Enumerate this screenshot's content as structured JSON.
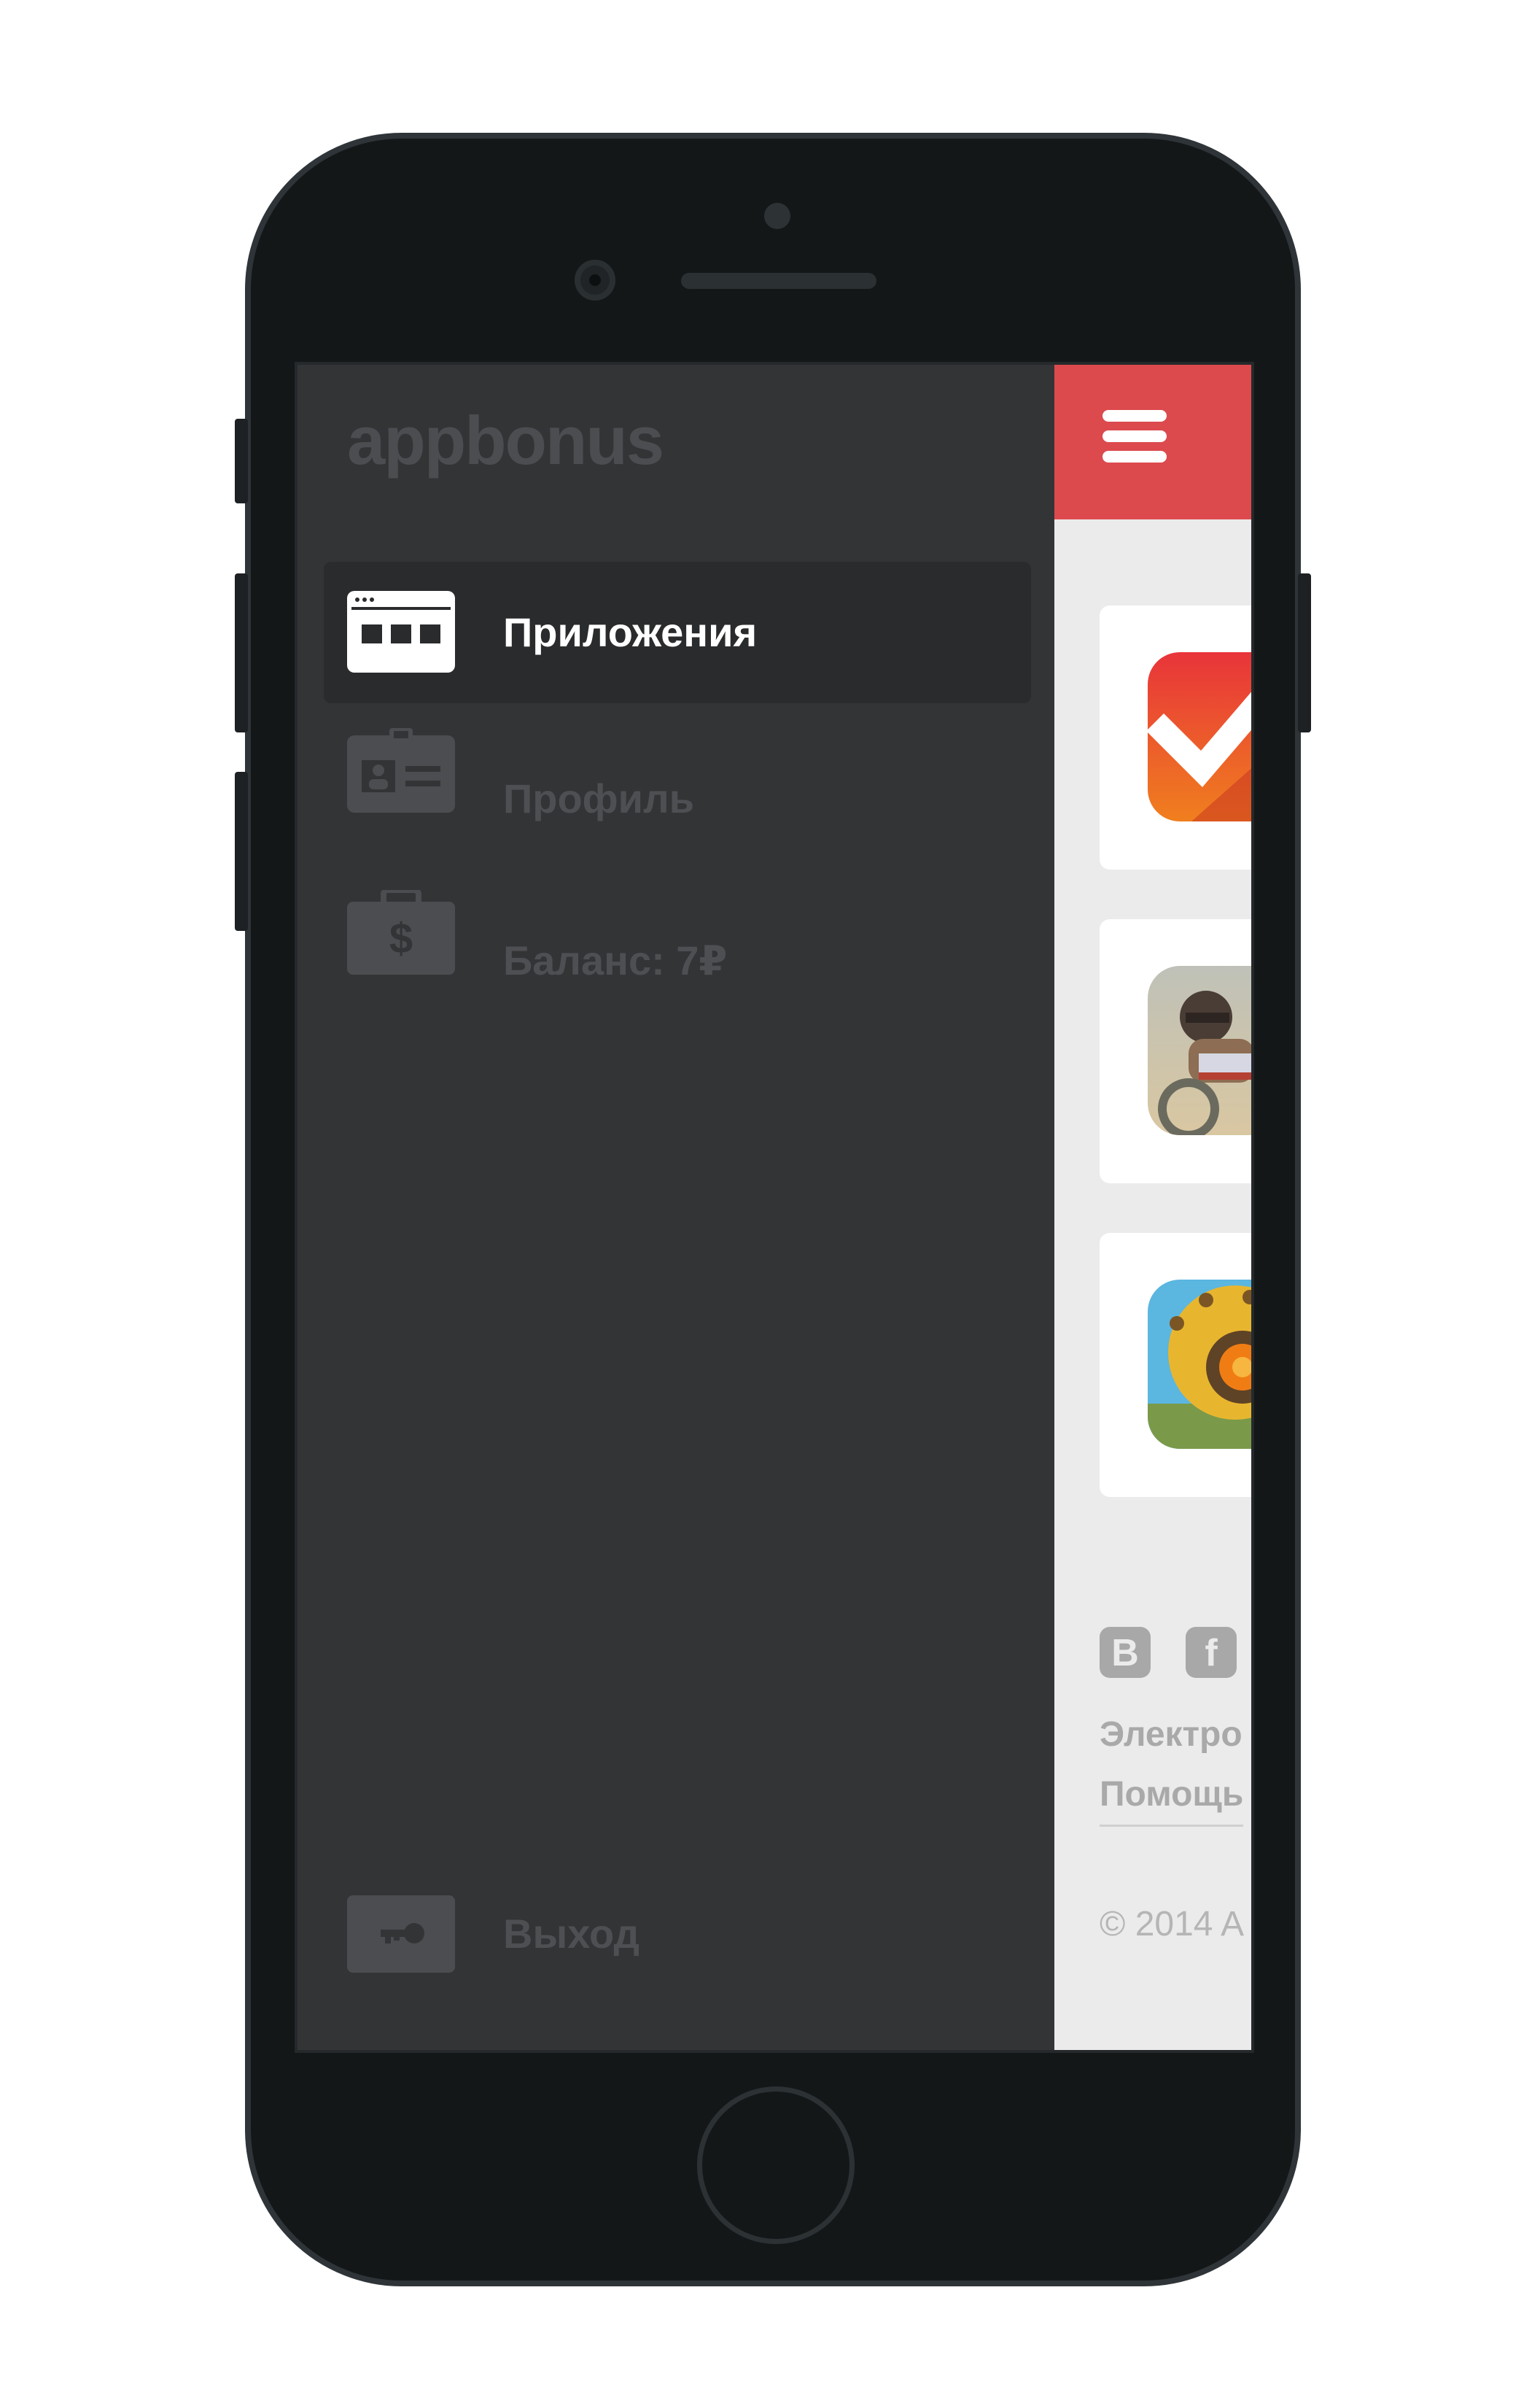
{
  "drawer": {
    "logo": "appbonus",
    "items": [
      {
        "label": "Приложения",
        "icon": "apps-window-icon",
        "active": true
      },
      {
        "label": "Профиль",
        "icon": "id-card-icon",
        "active": false
      },
      {
        "label": "Баланс: 7₽",
        "icon": "money-bag-icon",
        "active": false
      }
    ],
    "logout": {
      "label": "Выход",
      "icon": "key-icon"
    }
  },
  "page": {
    "header_color": "#dc4a4e",
    "apps": [
      {
        "icon": "checkmark-app-icon"
      },
      {
        "icon": "rider-game-app-icon"
      },
      {
        "icon": "robot-game-app-icon"
      }
    ],
    "footer": {
      "social": [
        "В",
        "f"
      ],
      "email_label": "Электро",
      "help_label": "Помощь",
      "copyright": "© 2014 A"
    }
  }
}
